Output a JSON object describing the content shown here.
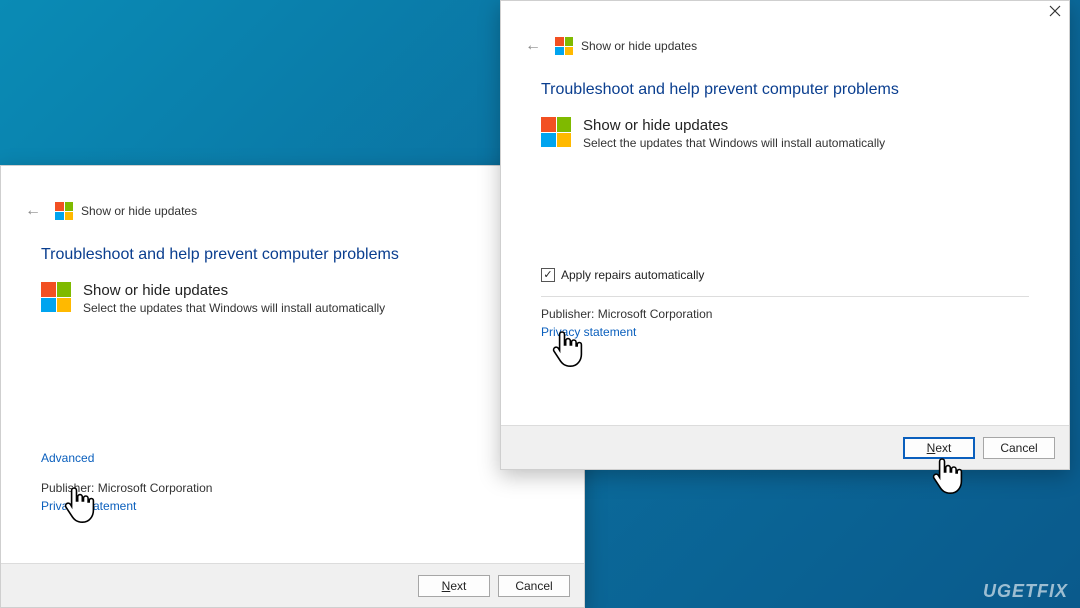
{
  "dialog_back": {
    "title": "Show or hide updates",
    "heading": "Troubleshoot and help prevent computer problems",
    "section_title": "Show or hide updates",
    "section_sub": "Select the updates that Windows will install automatically",
    "advanced_link": "Advanced",
    "publisher_label": "Publisher:",
    "publisher_value": "Microsoft Corporation",
    "privacy_link": "Privacy statement",
    "next_label": "Next",
    "cancel_label": "Cancel"
  },
  "dialog_front": {
    "title": "Show or hide updates",
    "heading": "Troubleshoot and help prevent computer problems",
    "section_title": "Show or hide updates",
    "section_sub": "Select the updates that Windows will install automatically",
    "checkbox_label": "Apply repairs automatically",
    "checkbox_checked": "✓",
    "publisher_label": "Publisher:",
    "publisher_value": "Microsoft Corporation",
    "privacy_link": "Privacy statement",
    "next_label": "Next",
    "cancel_label": "Cancel"
  },
  "watermark": "UGETFIX"
}
